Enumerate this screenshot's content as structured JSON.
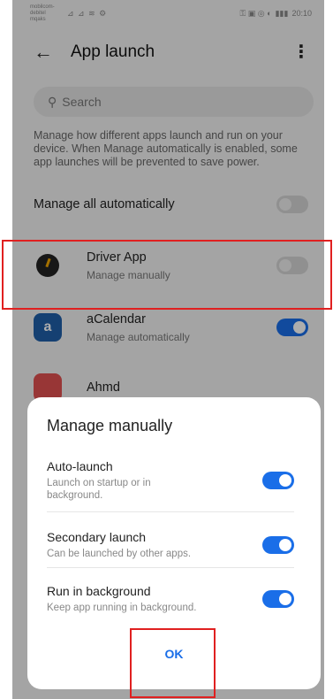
{
  "status_bar": {
    "carrier": "mobilcom-debitel\nmqaks",
    "signal_icons": "⊿ ⊿ ≋ ⚙",
    "right_icons": "⚿ ▣ ◎ ◐",
    "battery": "▮▮▮",
    "time": "20:10"
  },
  "header": {
    "title": "App launch",
    "back_icon": "←",
    "menu_icon": "⋮"
  },
  "search": {
    "icon": "⚲",
    "placeholder": "Search"
  },
  "description": "Manage how different apps launch and run on your device. When Manage automatically is enabled, some app launches will be prevented to save power.",
  "manage_all": {
    "label": "Manage all automatically",
    "toggle": "off"
  },
  "apps": [
    {
      "name": "Driver App",
      "status": "Manage manually",
      "toggle": "off",
      "icon": "driver-app-icon"
    },
    {
      "name": "aCalendar",
      "status": "Manage automatically",
      "toggle": "on",
      "icon": "acalendar-icon",
      "icon_glyph": "a"
    },
    {
      "name": "Ahmd",
      "status": "",
      "toggle": "on",
      "icon": "partial-app-icon"
    }
  ],
  "dialog": {
    "title": "Manage manually",
    "options": [
      {
        "title": "Auto-launch",
        "subtitle": "Launch on startup or in background.",
        "toggle": "on"
      },
      {
        "title": "Secondary launch",
        "subtitle": "Can be launched by other apps.",
        "toggle": "on"
      },
      {
        "title": "Run in background",
        "subtitle": "Keep app running in background.",
        "toggle": "on"
      }
    ],
    "ok_label": "OK"
  },
  "colors": {
    "accent": "#1a6ee8",
    "highlight": "#e02020",
    "toggle_off": "#d4d4d4"
  }
}
